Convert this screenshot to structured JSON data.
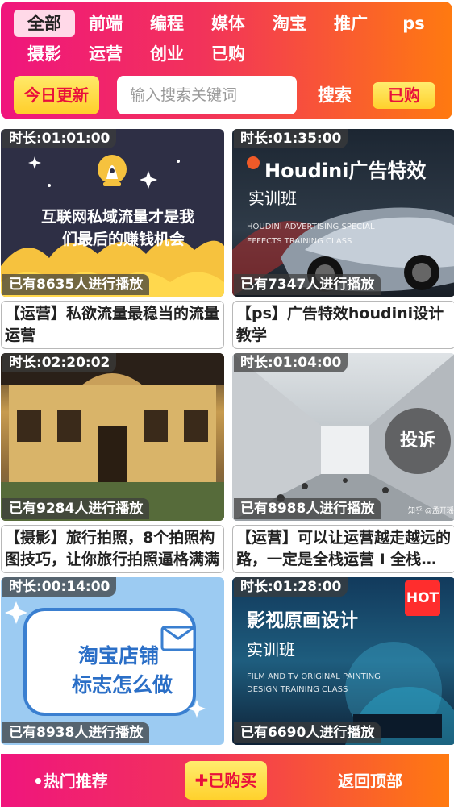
{
  "nav": {
    "categories": [
      "全部",
      "前端",
      "编程",
      "媒体",
      "淘宝",
      "推广",
      "ps",
      "摄影",
      "运营",
      "创业",
      "已购"
    ],
    "active_index": 0
  },
  "toolbar": {
    "today_label": "今日更新",
    "search_placeholder": "输入搜索关键词",
    "search_label": "搜索",
    "bought_label": "已购"
  },
  "videos": [
    {
      "duration": "时长:01:01:00",
      "plays": "已有8635人进行播放",
      "title": "【运营】私欲流量最稳当的流量运营",
      "thumb_text": [
        "互联网私域流量才是我",
        "们最后的赚钱机会"
      ]
    },
    {
      "duration": "时长:01:35:00",
      "plays": "已有7347人进行播放",
      "title": "【ps】广告特效houdini设计教学",
      "thumb_text": [
        "Houdini广告特效",
        "实训班",
        "HOUDINI ADVERTISING SPECIAL",
        "EFFECTS TRAINING CLASS"
      ]
    },
    {
      "duration": "时长:02:20:02",
      "plays": "已有9284人进行播放",
      "title": "【摄影】旅行拍照，8个拍照构图技巧，让你旅行拍照逼格满满",
      "thumb_text": []
    },
    {
      "duration": "时长:01:04:00",
      "plays": "已有8988人进行播放",
      "title": "【运营】可以让运营越走越远的路，一定是全栈运营 I 全栈运营",
      "thumb_text": [
        "投诉",
        "知乎 @孟开瑶"
      ]
    },
    {
      "duration": "时长:00:14:00",
      "plays": "已有8938人进行播放",
      "title": "",
      "thumb_text": [
        "淘宝店铺",
        "标志怎么做"
      ]
    },
    {
      "duration": "时长:01:28:00",
      "plays": "已有6690人进行播放",
      "title": "",
      "thumb_text": [
        "影视原画设计",
        "实训班",
        "FILM AND TV ORIGINAL PAINTING",
        "DESIGN TRAINING CLASS",
        "HOT"
      ]
    }
  ],
  "footer": {
    "hot_label": "•热门推荐",
    "buy_label": "✚已购买",
    "top_label": "返回顶部"
  },
  "colors": {
    "gradient_start": "#f0157d",
    "gradient_end": "#ff7a10",
    "button_yellow": "#ffd12c",
    "button_text_red": "#e9103b"
  }
}
